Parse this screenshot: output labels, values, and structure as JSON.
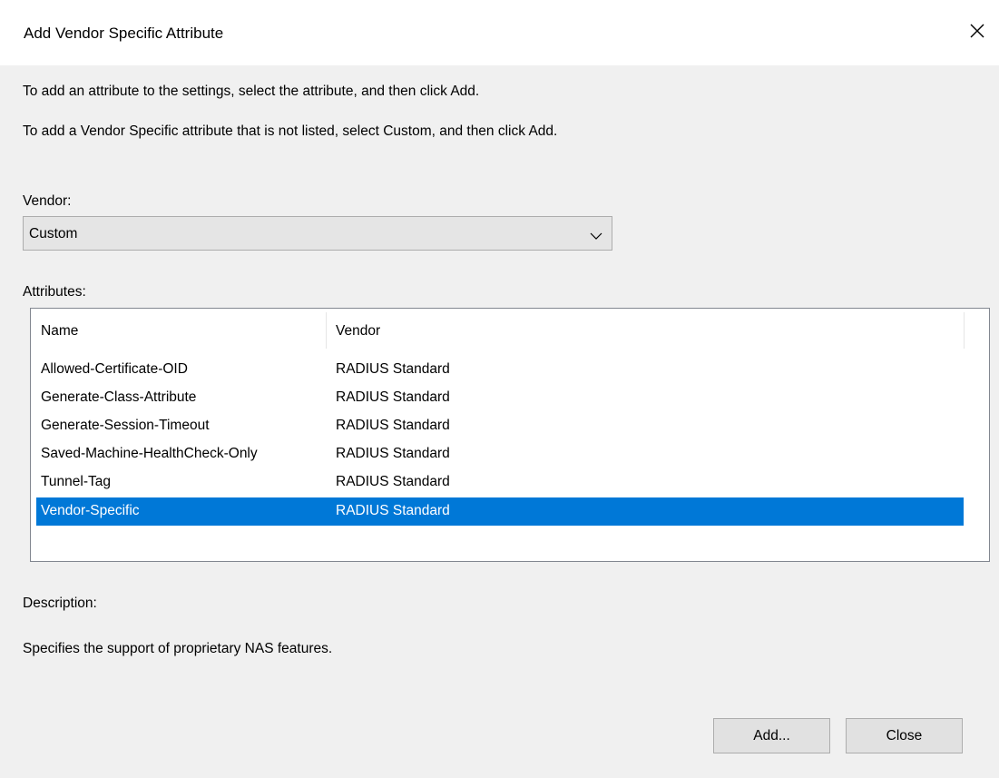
{
  "window": {
    "title": "Add Vendor Specific Attribute"
  },
  "instructions": {
    "line1": "To add an attribute to the settings, select the attribute, and then click Add.",
    "line2": "To add a Vendor Specific attribute that is not listed, select Custom, and then click Add."
  },
  "vendor": {
    "label": "Vendor:",
    "selected": "Custom"
  },
  "attributes": {
    "label": "Attributes:",
    "columns": [
      "Name",
      "Vendor"
    ],
    "rows": [
      {
        "name": "Allowed-Certificate-OID",
        "vendor": "RADIUS Standard"
      },
      {
        "name": "Generate-Class-Attribute",
        "vendor": "RADIUS Standard"
      },
      {
        "name": "Generate-Session-Timeout",
        "vendor": "RADIUS Standard"
      },
      {
        "name": "Saved-Machine-HealthCheck-Only",
        "vendor": "RADIUS Standard"
      },
      {
        "name": "Tunnel-Tag",
        "vendor": "RADIUS Standard"
      },
      {
        "name": "Vendor-Specific",
        "vendor": "RADIUS Standard"
      }
    ],
    "selected_index": 5
  },
  "description": {
    "label": "Description:",
    "text": "Specifies the support of proprietary NAS features."
  },
  "buttons": {
    "add_label": "Add...",
    "close_label": "Close"
  },
  "colors": {
    "selection": "#0078d7",
    "dialog_background": "#f0f0f0"
  }
}
